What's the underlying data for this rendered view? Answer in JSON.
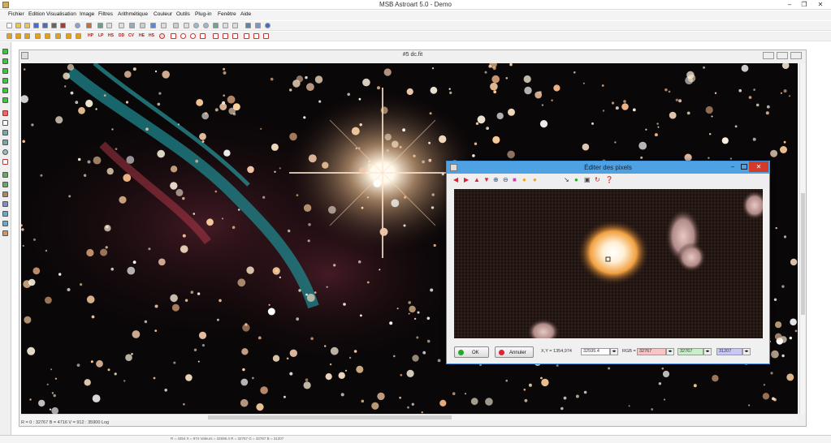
{
  "app": {
    "title": "MSB Astroart 5.0 - Demo",
    "min": "–",
    "max": "❐",
    "close": "✕"
  },
  "menu": [
    "Fichier",
    "Edition",
    "Visualisation",
    "Image",
    "Filtres",
    "Arithmétique",
    "Couleur",
    "Outils",
    "Plug-in",
    "Fenêtre",
    "Aide"
  ],
  "colors": {
    "accent": "#4ea2e4",
    "close": "#d23a2a",
    "r_field": "#f8c4c4",
    "g_field": "#c8f0c8",
    "b_field": "#c8c8f8"
  },
  "toolbar2_labels": [
    "HP",
    "LP",
    "HS",
    "DD",
    "CV",
    "HE",
    "HS"
  ],
  "image_window": {
    "title": "#5 dc.fit",
    "status": "R = 0 : 32767   B = 4716   V = 912 : 35900 Log"
  },
  "pixel_editor": {
    "title": "Éditer des pixels",
    "ok": "OK",
    "cancel": "Annuler",
    "xy_label": "X,Y = 1354,974",
    "value": "32595.4",
    "rgb_label": "RGB =",
    "r": "32767",
    "g": "32767",
    "b": "31207"
  },
  "statusbar": {
    "text": "R = 4354  X = 974  Valeurs = 32595.4  R = 32767  G = 32767  B = 31207"
  }
}
